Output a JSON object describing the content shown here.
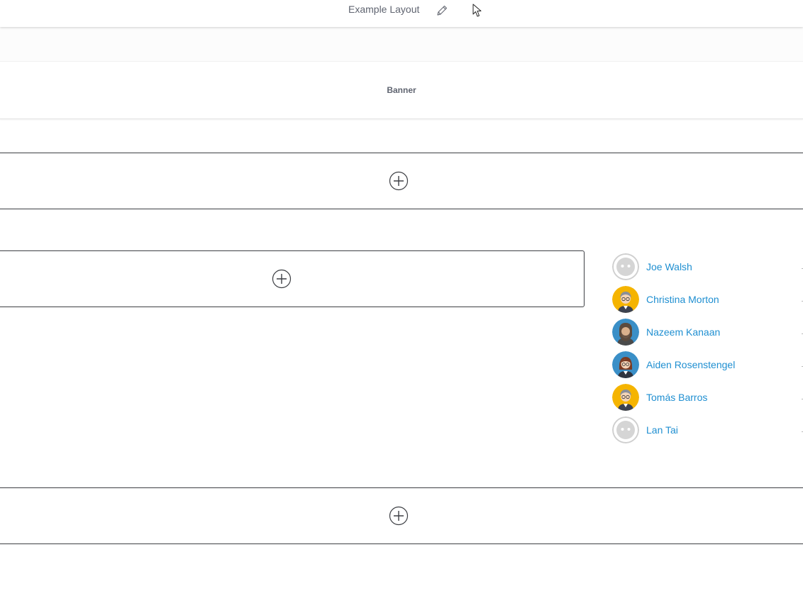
{
  "header": {
    "title": "Example Layout",
    "edit_icon": "pencil-icon",
    "cursor_icon": "mouse-cursor-icon"
  },
  "banner": {
    "label": "Banner"
  },
  "drop_zones": {
    "add_icon": "plus-circle-icon"
  },
  "users": [
    {
      "name": "Joe Walsh",
      "avatar": "default"
    },
    {
      "name": "Christina Morton",
      "avatar": "woman-yellow"
    },
    {
      "name": "Nazeem Kanaan",
      "avatar": "bearded-man-blue"
    },
    {
      "name": "Aiden Rosenstengel",
      "avatar": "woman-blue"
    },
    {
      "name": "Tomás Barros",
      "avatar": "woman-yellow"
    },
    {
      "name": "Lan Tai",
      "avatar": "default"
    }
  ],
  "colors": {
    "link": "#1f8fd1",
    "border": "#3d3f44",
    "title": "#5f6470",
    "avatar_yellow": "#f5b400",
    "avatar_blue": "#3a8fc7"
  }
}
